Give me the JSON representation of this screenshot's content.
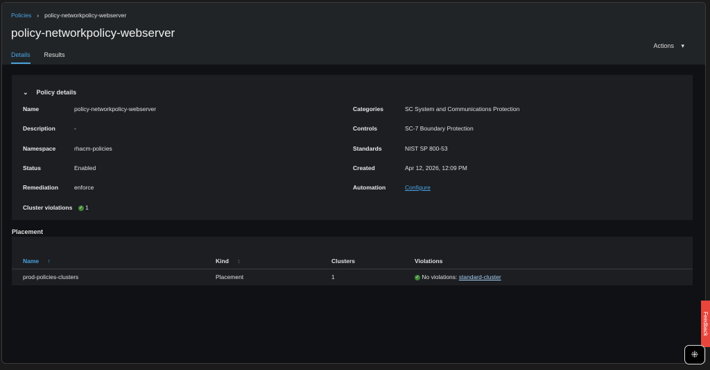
{
  "breadcrumb": {
    "root": "Policies",
    "current": "policy-networkpolicy-webserver"
  },
  "title": "policy-networkpolicy-webserver",
  "actions_label": "Actions",
  "tabs": [
    {
      "label": "Details"
    },
    {
      "label": "Results"
    }
  ],
  "details": {
    "heading": "Policy details",
    "left": [
      {
        "label": "Name",
        "value": "policy-networkpolicy-webserver"
      },
      {
        "label": "Description",
        "value": "-"
      },
      {
        "label": "Namespace",
        "value": "rhacm-policies"
      },
      {
        "label": "Status",
        "value": "Enabled"
      },
      {
        "label": "Remediation",
        "value": "enforce"
      },
      {
        "label": "Cluster violations",
        "value": "1"
      }
    ],
    "right": [
      {
        "label": "Categories",
        "value": "SC System and Communications Protection"
      },
      {
        "label": "Controls",
        "value": "SC-7 Boundary Protection"
      },
      {
        "label": "Standards",
        "value": "NIST SP 800-53"
      },
      {
        "label": "Created",
        "value": "Apr 12, 2026, 12:09 PM"
      },
      {
        "label": "Automation",
        "value": "Configure"
      }
    ]
  },
  "placement": {
    "heading": "Placement",
    "columns": [
      "Name",
      "Kind",
      "Clusters",
      "Violations"
    ],
    "rows": [
      {
        "name": "prod-policies-clusters",
        "kind": "Placement",
        "clusters": "1",
        "violations_text": "No violations:",
        "violations_link": "standard-cluster"
      }
    ]
  },
  "feedback_label": "Feedback",
  "colors": {
    "accent": "#4aa3e0",
    "success": "#3e8635",
    "feedback": "#e8453c"
  }
}
